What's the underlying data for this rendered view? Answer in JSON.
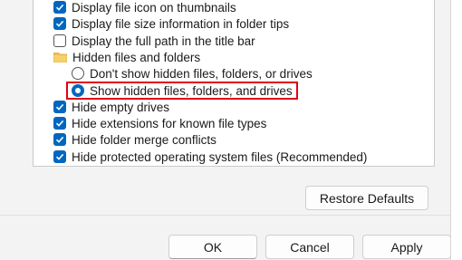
{
  "options": [
    {
      "kind": "checkbox",
      "checked": true,
      "label": "Display file icon on thumbnails"
    },
    {
      "kind": "checkbox",
      "checked": true,
      "label": "Display file size information in folder tips"
    },
    {
      "kind": "checkbox",
      "checked": false,
      "label": "Display the full path in the title bar"
    },
    {
      "kind": "folder",
      "label": "Hidden files and folders"
    },
    {
      "kind": "radio",
      "checked": false,
      "label": "Don't show hidden files, folders, or drives"
    },
    {
      "kind": "radio",
      "checked": true,
      "label": "Show hidden files, folders, and drives"
    },
    {
      "kind": "checkbox",
      "checked": true,
      "label": "Hide empty drives"
    },
    {
      "kind": "checkbox",
      "checked": true,
      "label": "Hide extensions for known file types"
    },
    {
      "kind": "checkbox",
      "checked": true,
      "label": "Hide folder merge conflicts"
    },
    {
      "kind": "checkbox",
      "checked": true,
      "label": "Hide protected operating system files (Recommended)"
    }
  ],
  "buttons": {
    "restore_defaults": "Restore Defaults",
    "ok": "OK",
    "cancel": "Cancel",
    "apply": "Apply"
  },
  "colors": {
    "accent": "#0067c0",
    "highlight_box": "#e0001b"
  }
}
